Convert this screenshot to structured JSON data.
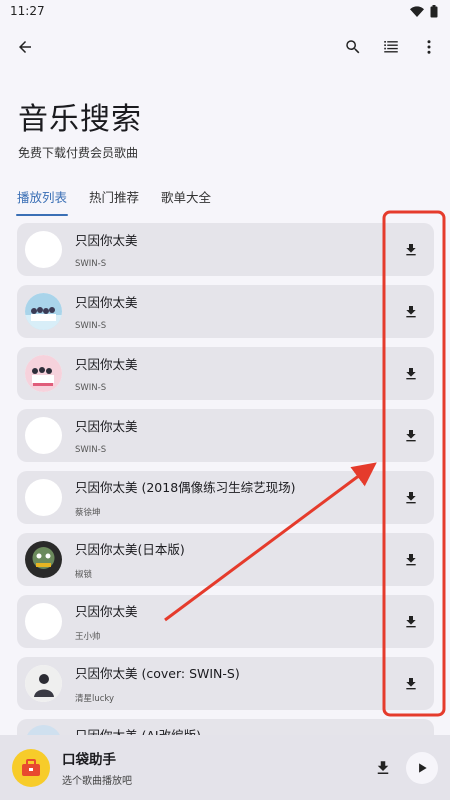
{
  "status_bar": {
    "time": "11:27"
  },
  "header": {
    "title": "音乐搜索",
    "subtitle": "免费下载付费会员歌曲"
  },
  "tabs": [
    {
      "label": "播放列表",
      "active": true
    },
    {
      "label": "热门推荐",
      "active": false
    },
    {
      "label": "歌单大全",
      "active": false
    }
  ],
  "songs": [
    {
      "title": "只因你太美",
      "artist": "SWIN-S"
    },
    {
      "title": "只因你太美",
      "artist": "SWIN-S"
    },
    {
      "title": "只因你太美",
      "artist": "SWIN-S"
    },
    {
      "title": "只因你太美",
      "artist": "SWIN-S"
    },
    {
      "title": "只因你太美 (2018偶像练习生综艺现场)",
      "artist": "蔡徐坤"
    },
    {
      "title": "只因你太美(日本版)",
      "artist": "椒锁"
    },
    {
      "title": "只因你太美",
      "artist": "王小帅"
    },
    {
      "title": "只因你太美 (cover: SWIN-S)",
      "artist": "清星lucky"
    },
    {
      "title": "只因你太美 (AI改编版)",
      "artist": ""
    }
  ],
  "player": {
    "name": "口袋助手",
    "subtitle": "选个歌曲播放吧"
  },
  "colors": {
    "accent": "#3a6fb5",
    "annotation": "#e53b2c",
    "logo": "#f7cc2a"
  },
  "icons": [
    "back-arrow-icon",
    "search-icon",
    "queue-list-icon",
    "more-vert-icon",
    "download-icon",
    "play-icon"
  ]
}
